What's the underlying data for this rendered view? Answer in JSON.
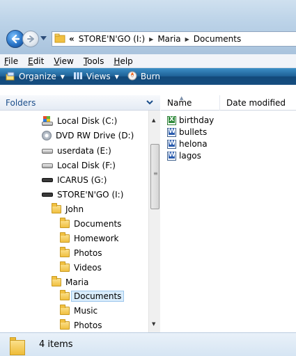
{
  "address": {
    "chevron": "«",
    "crumbs": [
      "STORE'N'GO (I:)",
      "Maria",
      "Documents"
    ]
  },
  "menu": [
    {
      "label": "File",
      "u": "F",
      "rest": "ile"
    },
    {
      "label": "Edit",
      "u": "E",
      "rest": "dit"
    },
    {
      "label": "View",
      "u": "V",
      "rest": "iew"
    },
    {
      "label": "Tools",
      "u": "T",
      "rest": "ools"
    },
    {
      "label": "Help",
      "u": "H",
      "rest": "elp"
    }
  ],
  "commands": {
    "organize": "Organize",
    "views": "Views",
    "burn": "Burn"
  },
  "folders_pane": {
    "title": "Folders",
    "tree": [
      {
        "label": "Local Disk (C:)",
        "icon": "local-disk-icon"
      },
      {
        "label": "DVD RW Drive (D:)",
        "icon": "dvd-drive-icon"
      },
      {
        "label": "userdata (E:)",
        "icon": "drive-icon"
      },
      {
        "label": "Local Disk (F:)",
        "icon": "drive-icon"
      },
      {
        "label": "ICARUS (G:)",
        "icon": "usb-drive-icon"
      },
      {
        "label": "STORE'N'GO (I:)",
        "icon": "usb-drive-icon"
      },
      {
        "label": "John",
        "icon": "folder-icon"
      },
      {
        "label": "Documents",
        "icon": "folder-icon"
      },
      {
        "label": "Homework",
        "icon": "folder-icon"
      },
      {
        "label": "Photos",
        "icon": "folder-icon"
      },
      {
        "label": "Videos",
        "icon": "folder-icon"
      },
      {
        "label": "Maria",
        "icon": "folder-icon"
      },
      {
        "label": "Documents",
        "icon": "folder-icon",
        "selected": true
      },
      {
        "label": "Music",
        "icon": "folder-icon"
      },
      {
        "label": "Photos",
        "icon": "folder-icon"
      }
    ]
  },
  "content": {
    "columns": {
      "name": "Name",
      "date": "Date modified"
    },
    "files": [
      {
        "name": "birthday",
        "icon": "excel-file-icon"
      },
      {
        "name": "bullets",
        "icon": "word-file-icon"
      },
      {
        "name": "helona",
        "icon": "word-file-icon"
      },
      {
        "name": "lagos",
        "icon": "word-file-icon"
      }
    ]
  },
  "details": {
    "count": "4 items"
  },
  "colors": {
    "command_bar": "#1d5f95",
    "selection": "#d9ecfb",
    "folder": "#f1c040"
  }
}
